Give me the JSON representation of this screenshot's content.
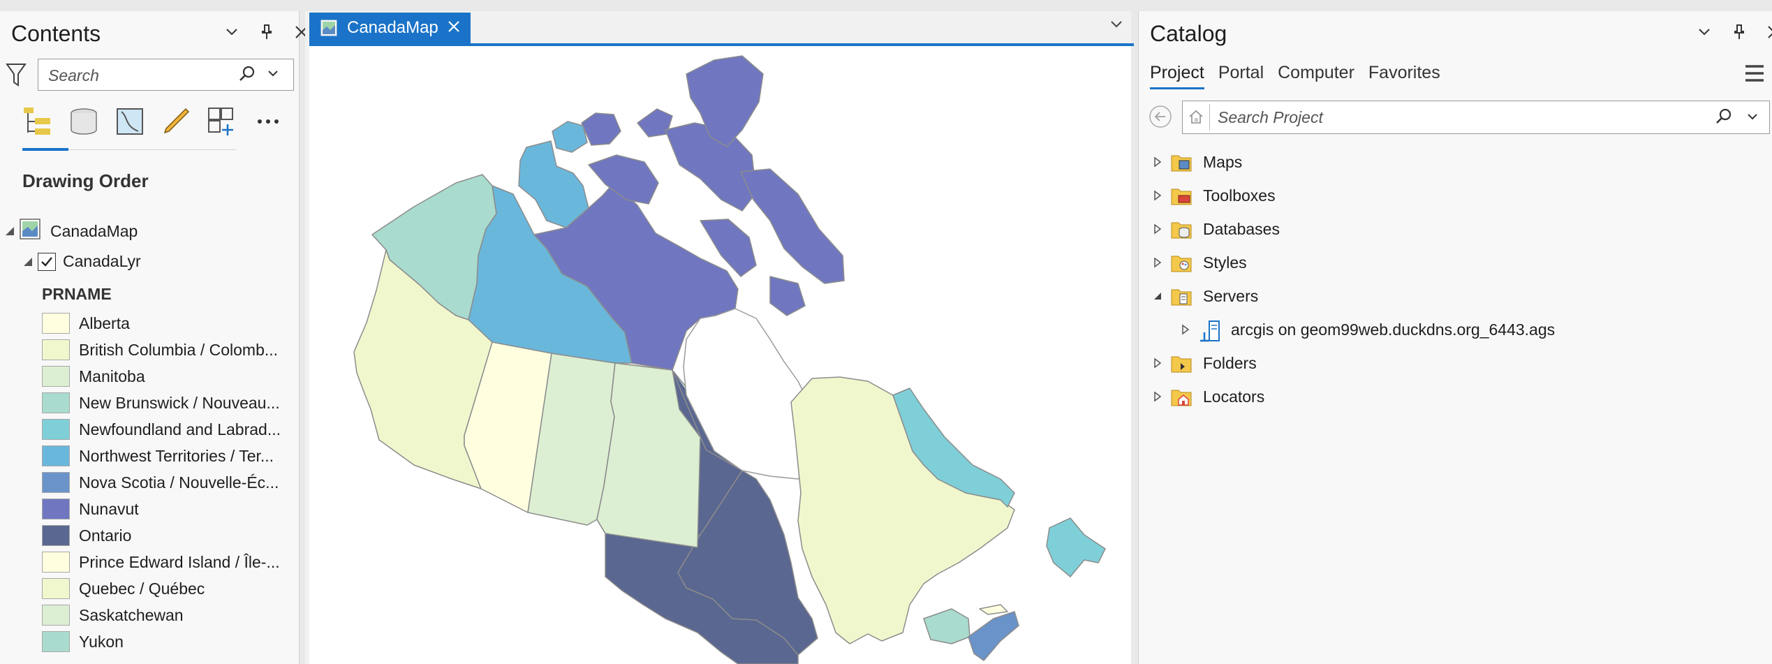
{
  "contents": {
    "title": "Contents",
    "search_placeholder": "Search",
    "drawing_order_label": "Drawing Order",
    "map_name": "CanadaMap",
    "layer_name": "CanadaLyr",
    "field_name": "PRNAME",
    "legend": [
      {
        "label": "Alberta",
        "color": "#ffffe0"
      },
      {
        "label": "British Columbia / Colomb...",
        "color": "#f1f7cd"
      },
      {
        "label": "Manitoba",
        "color": "#dcefd2"
      },
      {
        "label": "New Brunswick / Nouveau...",
        "color": "#a9dbce"
      },
      {
        "label": "Newfoundland and Labrad...",
        "color": "#7ecfd8"
      },
      {
        "label": "Northwest Territories / Ter...",
        "color": "#6ab7dc"
      },
      {
        "label": "Nova Scotia / Nouvelle-Éc...",
        "color": "#6a93c9"
      },
      {
        "label": "Nunavut",
        "color": "#7077c0"
      },
      {
        "label": "Ontario",
        "color": "#5a6790"
      },
      {
        "label": "Prince Edward Island / Île-...",
        "color": "#ffffe0"
      },
      {
        "label": "Quebec / Québec",
        "color": "#f1f7cd"
      },
      {
        "label": "Saskatchewan",
        "color": "#dcefd2"
      },
      {
        "label": "Yukon",
        "color": "#a9dbce"
      }
    ]
  },
  "map_view": {
    "tab_label": "CanadaMap"
  },
  "catalog": {
    "title": "Catalog",
    "tabs": [
      "Project",
      "Portal",
      "Computer",
      "Favorites"
    ],
    "active_tab": "Project",
    "search_placeholder": "Search Project",
    "items": [
      {
        "label": "Maps",
        "icon": "maps-folder-icon",
        "expanded": false
      },
      {
        "label": "Toolboxes",
        "icon": "toolboxes-folder-icon",
        "expanded": false
      },
      {
        "label": "Databases",
        "icon": "databases-folder-icon",
        "expanded": false
      },
      {
        "label": "Styles",
        "icon": "styles-folder-icon",
        "expanded": false
      },
      {
        "label": "Servers",
        "icon": "servers-folder-icon",
        "expanded": true
      },
      {
        "label": "arcgis on geom99web.duckdns.org_6443.ags",
        "icon": "server-connection-icon",
        "expanded": false,
        "child": true
      },
      {
        "label": "Folders",
        "icon": "folders-folder-icon",
        "expanded": false
      },
      {
        "label": "Locators",
        "icon": "locators-folder-icon",
        "expanded": false
      }
    ]
  }
}
